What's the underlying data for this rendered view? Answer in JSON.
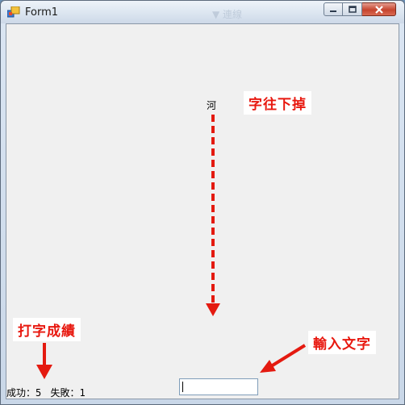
{
  "window": {
    "title": "Form1",
    "ghost_text": "▼ 連線"
  },
  "game": {
    "falling_char": "河",
    "score": {
      "success_label": "成功：5",
      "fail_label": "失敗：1"
    },
    "input": {
      "value": "",
      "placeholder": ""
    }
  },
  "annotations": {
    "falling": "字往下掉",
    "score": "打字成績",
    "input": "輸入文字"
  },
  "colors": {
    "annotation": "#e8180f",
    "arrow": "#e41a10",
    "client_bg": "#f0f0f0"
  },
  "icons": [
    "app-icon",
    "minimize-icon",
    "maximize-icon",
    "close-icon",
    "arrow-down-icon",
    "arrow-left-icon"
  ]
}
